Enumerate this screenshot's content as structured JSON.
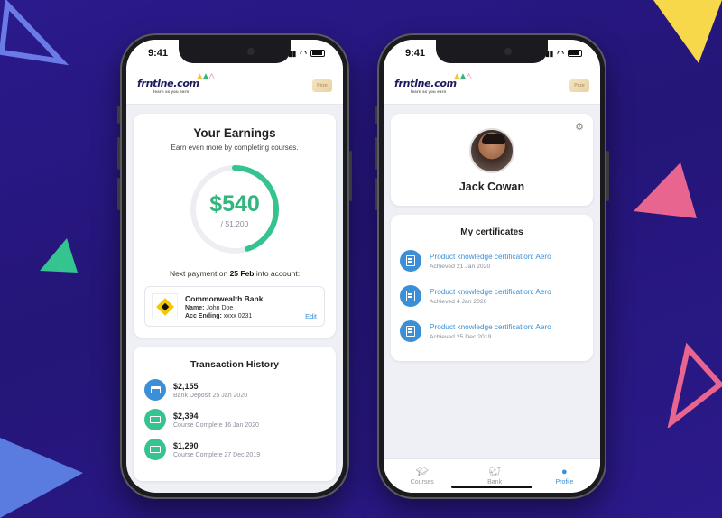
{
  "colors": {
    "accent": "#33b57e",
    "link": "#3a8fd6",
    "background": "#241578"
  },
  "left_phone": {
    "status_time": "9:41",
    "logo": {
      "text": "frntlne.com",
      "tagline": "learn as you earn"
    },
    "partner_badge": "Prize",
    "earnings": {
      "title": "Your Earnings",
      "subtitle": "Earn even more by completing courses.",
      "amount": "$540",
      "goal": "/ $1,200",
      "progress_fraction": 0.45,
      "next_payment_prefix": "Next payment on ",
      "next_payment_date": "25 Feb",
      "next_payment_suffix": " into account:",
      "bank": {
        "name": "Commonwealth Bank",
        "holder_label": "Name:",
        "holder_value": " John Doe",
        "acc_label": "Acc Ending:",
        "acc_value": " xxxx 0231",
        "edit_label": "Edit"
      }
    },
    "transactions": {
      "title": "Transaction History",
      "items": [
        {
          "amount": "$2,155",
          "desc": "Bank Deposit 25 Jan 2020",
          "icon": "card-icon"
        },
        {
          "amount": "$2,394",
          "desc": "Course Complete 16 Jan 2020",
          "icon": "cash-icon"
        },
        {
          "amount": "$1,290",
          "desc": "Course Complete 27 Dec 2019",
          "icon": "cash-icon"
        }
      ]
    }
  },
  "right_phone": {
    "status_time": "9:41",
    "profile": {
      "name": "Jack Cowan"
    },
    "certificates": {
      "title": "My certificates",
      "items": [
        {
          "title": "Product knowledge certification: Aero",
          "date": "Achieved 21 Jan 2020"
        },
        {
          "title": "Product knowledge certification: Aero",
          "date": "Achieved 4 Jan 2020"
        },
        {
          "title": "Product knowledge certification: Aero",
          "date": "Achieved 25 Dec 2019"
        }
      ]
    },
    "tabs": [
      {
        "label": "Courses",
        "icon": "graduation-cap-icon",
        "active": false
      },
      {
        "label": "Bank",
        "icon": "piggy-bank-icon",
        "active": false
      },
      {
        "label": "Profile",
        "icon": "user-icon",
        "active": true
      }
    ]
  }
}
